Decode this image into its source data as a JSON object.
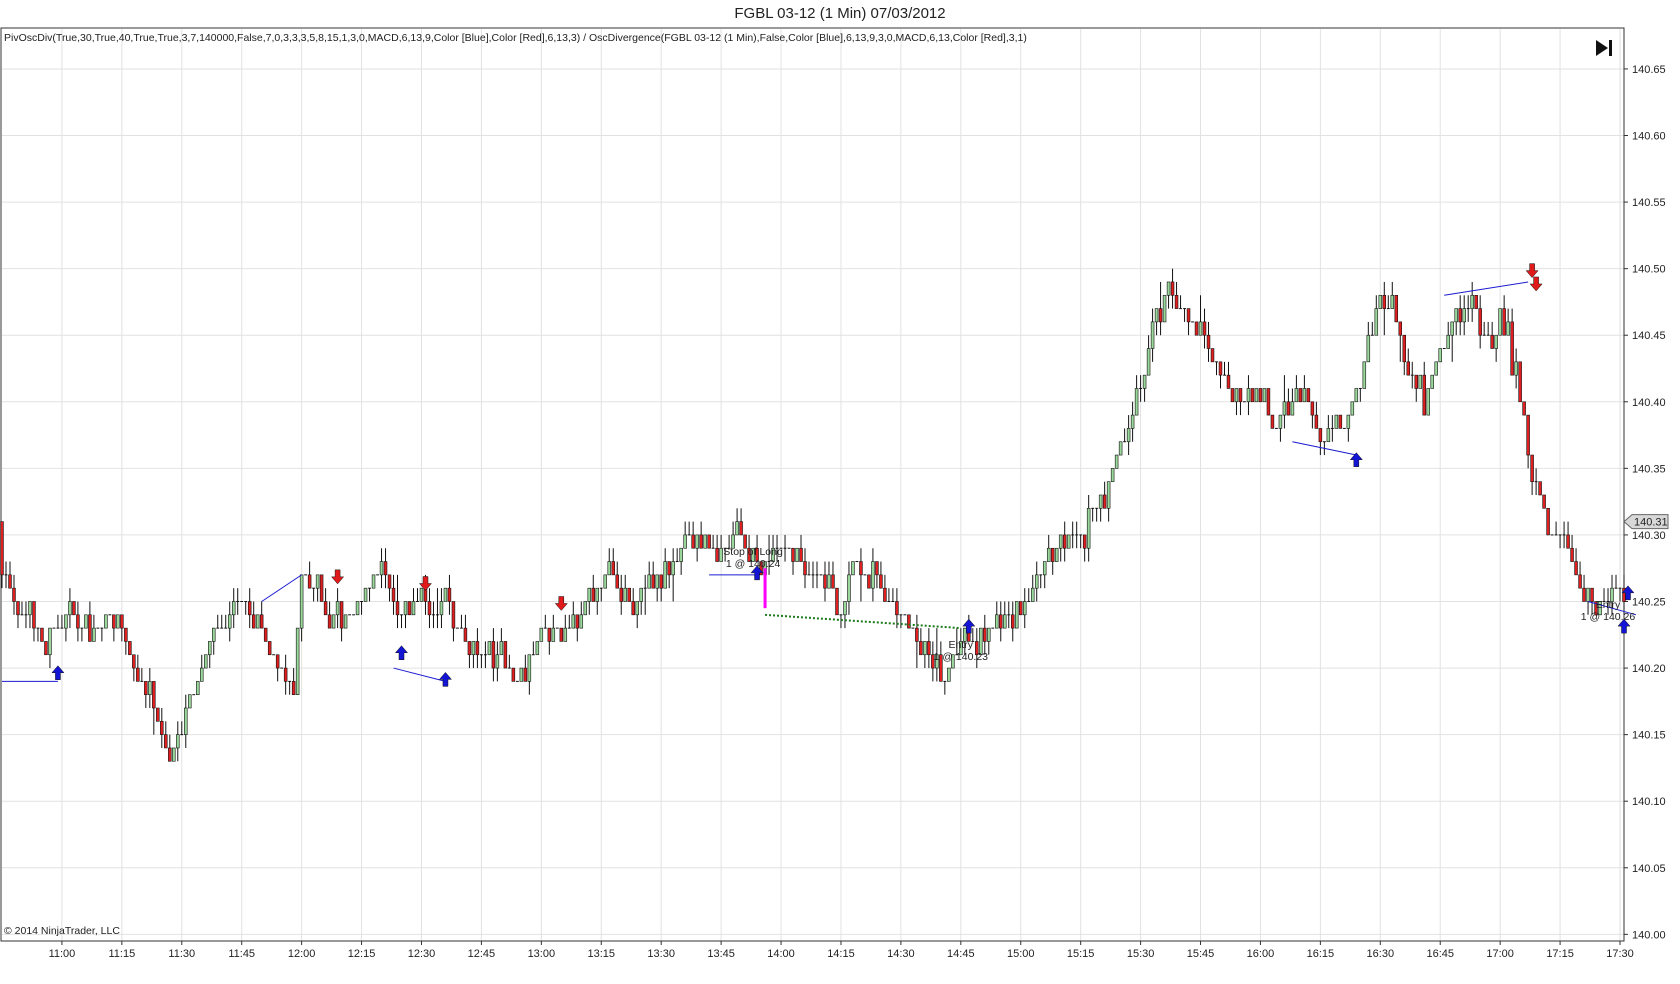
{
  "window": {
    "title": "FGBL 03-12 (1 Min)  07/03/2012"
  },
  "indicator_label": "PivOscDiv(True,30,True,40,True,True,3,7,140000,False,7,0,3,3,3,5,8,15,1,3,0,MACD,6,13,9,Color [Blue],Color [Red],6,13,3) / OscDivergence(FGBL 03-12 (1 Min),False,Color [Blue],6,13,9,3,0,MACD,6,13,Color [Red],3,1)",
  "copyright": "© 2014 NinjaTrader, LLC",
  "colors": {
    "up_candle": "#9bd89b",
    "down_candle": "#e02020",
    "grid": "#e2e2e2",
    "divergence_line": "#1a1ad0",
    "buy_arrow": "#1414d4",
    "sell_arrow": "#e01a1a",
    "price_marker": "#d8d8d8",
    "stop_marker": "#ff00ff",
    "trade_line": "#1a7a1a"
  },
  "chart_data": {
    "type": "candlestick",
    "title": "FGBL 03-12 (1 Min)  07/03/2012",
    "x_ticks": [
      "11:00",
      "11:15",
      "11:30",
      "11:45",
      "12:00",
      "12:15",
      "12:30",
      "12:45",
      "13:00",
      "13:15",
      "13:30",
      "13:45",
      "14:00",
      "14:15",
      "14:30",
      "14:45",
      "15:00",
      "15:15",
      "15:30",
      "15:45",
      "16:00",
      "16:15",
      "16:30",
      "16:45",
      "17:00",
      "17:15",
      "17:30"
    ],
    "y_ticks": [
      "140.00",
      "140.05",
      "140.10",
      "140.15",
      "140.20",
      "140.25",
      "140.30",
      "140.35",
      "140.40",
      "140.45",
      "140.50",
      "140.55",
      "140.60",
      "140.65"
    ],
    "ylim": [
      139.995,
      140.68
    ],
    "xlim_minutes": [
      645,
      1051
    ],
    "last_price": "140.31",
    "grid": true,
    "anchors": [
      [
        646,
        140.27
      ],
      [
        652,
        140.24
      ],
      [
        657,
        140.22
      ],
      [
        663,
        140.24
      ],
      [
        668,
        140.22
      ],
      [
        675,
        140.24
      ],
      [
        680,
        140.19
      ],
      [
        684,
        140.18
      ],
      [
        688,
        140.13
      ],
      [
        693,
        140.17
      ],
      [
        700,
        140.23
      ],
      [
        706,
        140.25
      ],
      [
        711,
        140.23
      ],
      [
        716,
        140.2
      ],
      [
        719,
        140.18
      ],
      [
        721,
        140.27
      ],
      [
        726,
        140.25
      ],
      [
        732,
        140.23
      ],
      [
        737,
        140.26
      ],
      [
        741,
        140.28
      ],
      [
        745,
        140.25
      ],
      [
        752,
        140.24
      ],
      [
        757,
        140.25
      ],
      [
        763,
        140.21
      ],
      [
        769,
        140.21
      ],
      [
        775,
        140.19
      ],
      [
        781,
        140.23
      ],
      [
        787,
        140.23
      ],
      [
        792,
        140.25
      ],
      [
        798,
        140.27
      ],
      [
        803,
        140.25
      ],
      [
        809,
        140.26
      ],
      [
        815,
        140.28
      ],
      [
        819,
        140.3
      ],
      [
        825,
        140.28
      ],
      [
        830,
        140.3
      ],
      [
        836,
        140.28
      ],
      [
        841,
        140.29
      ],
      [
        846,
        140.28
      ],
      [
        851,
        140.27
      ],
      [
        854,
        140.25
      ],
      [
        856,
        140.24
      ],
      [
        859,
        140.28
      ],
      [
        865,
        140.27
      ],
      [
        869,
        140.25
      ],
      [
        874,
        140.23
      ],
      [
        878,
        140.21
      ],
      [
        882,
        140.19
      ],
      [
        886,
        140.22
      ],
      [
        891,
        140.23
      ],
      [
        896,
        140.23
      ],
      [
        901,
        140.25
      ],
      [
        906,
        140.27
      ],
      [
        911,
        140.29
      ],
      [
        916,
        140.3
      ],
      [
        920,
        140.32
      ],
      [
        924,
        140.35
      ],
      [
        928,
        140.38
      ],
      [
        932,
        140.42
      ],
      [
        935,
        140.47
      ],
      [
        938,
        140.49
      ],
      [
        942,
        140.46
      ],
      [
        946,
        140.45
      ],
      [
        951,
        140.42
      ],
      [
        956,
        140.4
      ],
      [
        960,
        140.41
      ],
      [
        966,
        140.38
      ],
      [
        969,
        140.4
      ],
      [
        972,
        140.41
      ],
      [
        976,
        140.37
      ],
      [
        981,
        140.38
      ],
      [
        986,
        140.41
      ],
      [
        990,
        140.47
      ],
      [
        994,
        140.48
      ],
      [
        998,
        140.42
      ],
      [
        1002,
        140.4
      ],
      [
        1006,
        140.44
      ],
      [
        1011,
        140.47
      ],
      [
        1014,
        140.47
      ],
      [
        1017,
        140.45
      ],
      [
        1021,
        140.46
      ],
      [
        1025,
        140.42
      ],
      [
        1029,
        140.35
      ],
      [
        1033,
        140.3
      ],
      [
        1037,
        140.29
      ],
      [
        1041,
        140.27
      ],
      [
        1045,
        140.25
      ],
      [
        1049,
        140.26
      ],
      [
        1052,
        140.27
      ],
      [
        1057,
        140.31
      ]
    ],
    "divergence_lines": [
      [
        [
          645,
          140.19
        ],
        [
          659,
          140.19
        ]
      ],
      [
        [
          710,
          140.25
        ],
        [
          720,
          140.27
        ]
      ],
      [
        [
          743,
          140.2
        ],
        [
          756,
          140.19
        ]
      ],
      [
        [
          822,
          140.27
        ],
        [
          834,
          140.27
        ]
      ],
      [
        [
          968,
          140.37
        ],
        [
          984,
          140.36
        ]
      ],
      [
        [
          1006,
          140.48
        ],
        [
          1027,
          140.49
        ]
      ],
      [
        [
          1042,
          140.25
        ],
        [
          1054,
          140.24
        ]
      ]
    ],
    "buy_signals": [
      [
        659,
        140.195
      ],
      [
        745,
        140.21
      ],
      [
        756,
        140.19
      ],
      [
        834,
        140.27
      ],
      [
        887,
        140.23
      ],
      [
        984,
        140.355
      ],
      [
        1051,
        140.23
      ],
      [
        1052,
        140.255
      ]
    ],
    "sell_signals": [
      [
        729,
        140.27
      ],
      [
        751,
        140.265
      ],
      [
        785,
        140.25
      ],
      [
        1028,
        140.5
      ],
      [
        1029,
        140.49
      ]
    ],
    "trade_annotations": [
      {
        "line1": "Stop of Long",
        "line2": "1 @ 140.24",
        "minute": 833,
        "price": 140.285
      },
      {
        "line1": "Entry",
        "line2": "1 @ 140.23",
        "minute": 885,
        "price": 140.215
      },
      {
        "line1": "Entry",
        "line2": "1 @ 140.26",
        "minute": 1047,
        "price": 140.245
      }
    ],
    "trade_line": [
      [
        836,
        140.24
      ],
      [
        885,
        140.23
      ]
    ]
  }
}
